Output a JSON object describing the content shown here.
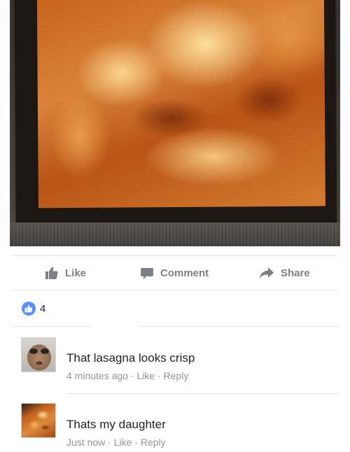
{
  "post": {
    "photo_alt": "ultrasound photo"
  },
  "actions": {
    "like_label": "Like",
    "comment_label": "Comment",
    "share_label": "Share"
  },
  "reactions": {
    "like_count": "4"
  },
  "comments": [
    {
      "text": "That lasagna looks crisp",
      "time": "4 minutes ago",
      "separator": "·",
      "like_label": "Like",
      "reply_label": "Reply"
    },
    {
      "text": "Thats my daughter",
      "time": "Just now",
      "separator": "·",
      "like_label": "Like",
      "reply_label": "Reply"
    }
  ],
  "colors": {
    "action_text": "#7c8088",
    "like_blue": "#5890ff",
    "meta_text": "#90949c",
    "body_text": "#1d2129",
    "divider": "#e4e6ea"
  },
  "icons": {
    "like": "thumbs-up-icon",
    "comment": "speech-bubble-icon",
    "share": "share-arrow-icon",
    "reaction": "like-reaction-icon"
  }
}
